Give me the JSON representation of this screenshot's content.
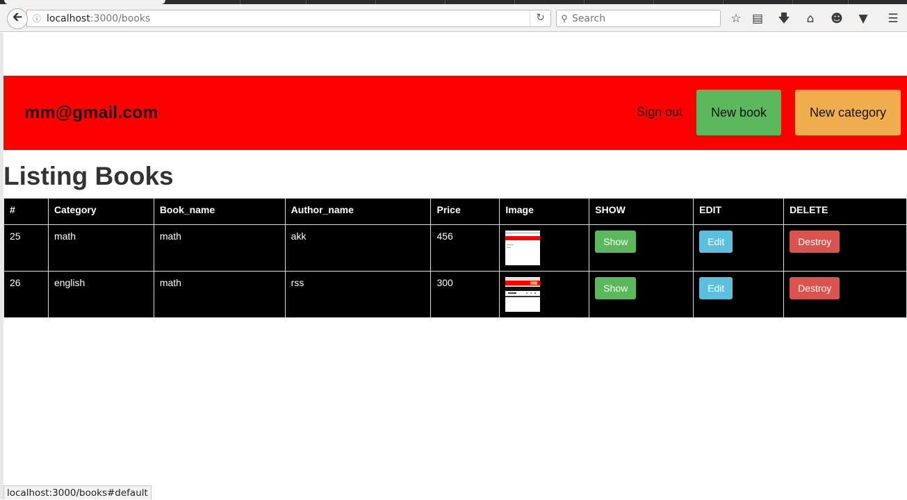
{
  "browser": {
    "url_host": "localhost",
    "url_rest": ":3000/books",
    "search_placeholder": "Search",
    "status_url": "localhost:3000/books#default",
    "icons": [
      "back-icon",
      "info-icon",
      "reload-icon",
      "search-icon",
      "star-icon",
      "reading-list-icon",
      "download-icon",
      "home-icon",
      "chat-icon",
      "pocket-icon",
      "menu-icon"
    ]
  },
  "header": {
    "user_email": "mm@gmail.com",
    "sign_out": "Sign out",
    "new_book": "New book",
    "new_category": "New category",
    "colors": {
      "header_bg": "#ff0000",
      "new_book_bg": "#5cb85c",
      "new_category_bg": "#f0ad4e"
    }
  },
  "main": {
    "title": "Listing Books",
    "columns": [
      "#",
      "Category",
      "Book_name",
      "Author_name",
      "Price",
      "Image",
      "SHOW",
      "EDIT",
      "DELETE"
    ],
    "rows": [
      {
        "id": "25",
        "category": "math",
        "book_name": "math",
        "author_name": "akk",
        "price": "456",
        "show": "Show",
        "edit": "Edit",
        "destroy": "Destroy"
      },
      {
        "id": "26",
        "category": "english",
        "book_name": "math",
        "author_name": "rss",
        "price": "300",
        "show": "Show",
        "edit": "Edit",
        "destroy": "Destroy"
      }
    ]
  }
}
